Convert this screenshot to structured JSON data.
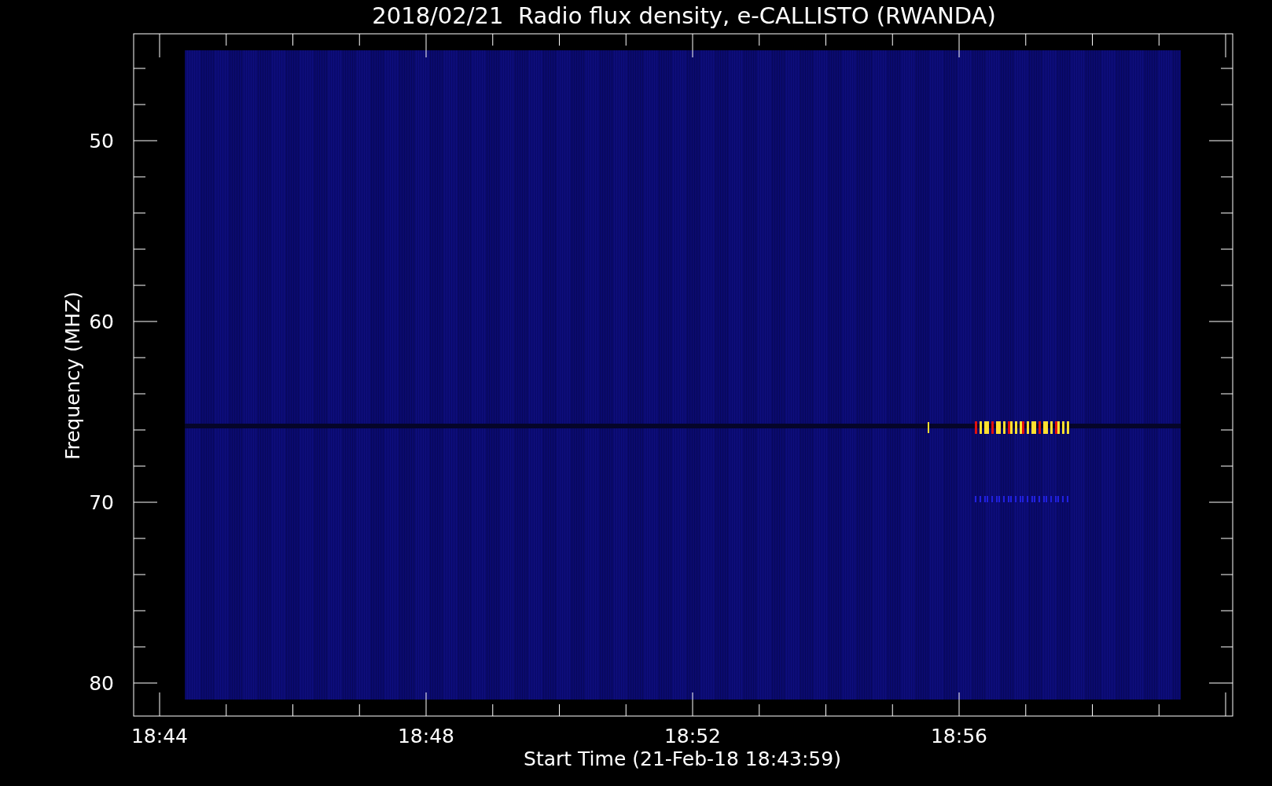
{
  "plot": {
    "title": "2018/02/21  Radio flux density, e-CALLISTO (RWANDA)",
    "ylabel": "Frequency (MHZ)",
    "xlabel": "Start Time (21-Feb-18 18:43:59)",
    "yticks": [
      "50",
      "60",
      "70",
      "80"
    ],
    "xticks": [
      "18:44",
      "18:48",
      "18:52",
      "18:56"
    ]
  }
}
